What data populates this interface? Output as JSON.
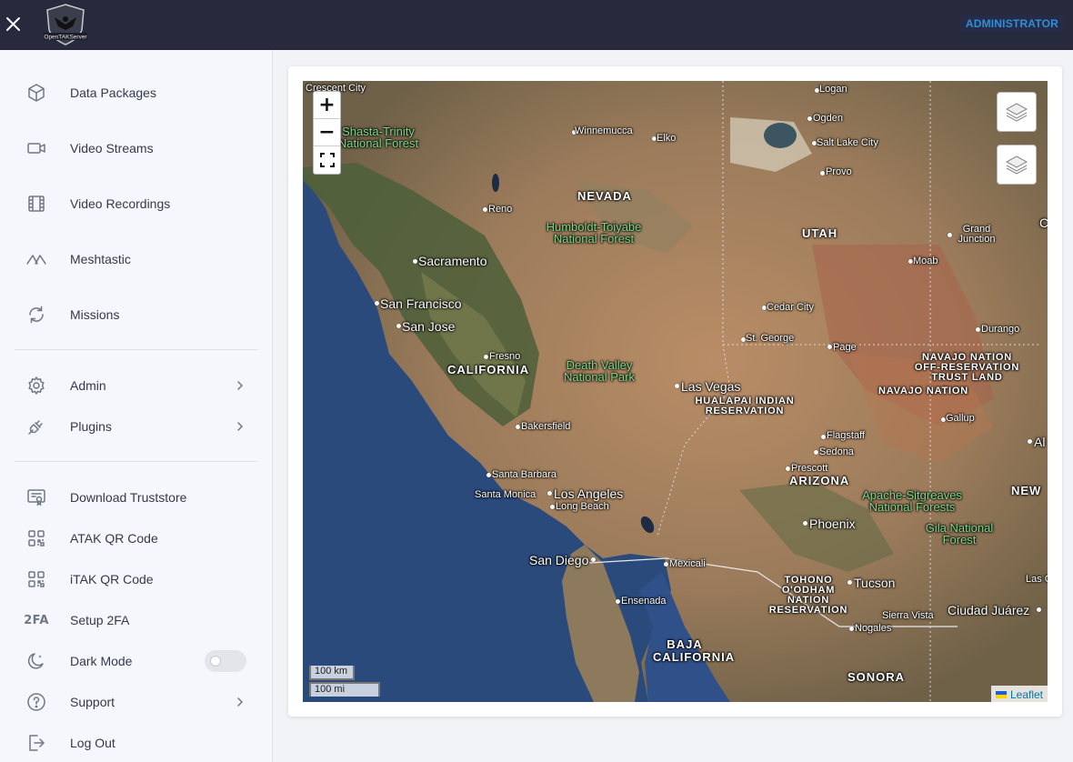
{
  "header": {
    "logo_text": "OpenTAKServer",
    "role_badge": "ADMINISTRATOR"
  },
  "sidebar": {
    "items": [
      {
        "label": "Data Packages",
        "icon": "box-icon"
      },
      {
        "label": "Video Streams",
        "icon": "video-camera-icon"
      },
      {
        "label": "Video Recordings",
        "icon": "film-icon"
      },
      {
        "label": "Meshtastic",
        "icon": "meshtastic-icon"
      },
      {
        "label": "Missions",
        "icon": "refresh-icon"
      },
      {
        "label": "Admin",
        "icon": "gear-icon"
      },
      {
        "label": "Plugins",
        "icon": "plug-icon"
      },
      {
        "label": "Download Truststore",
        "icon": "certificate-icon"
      },
      {
        "label": "ATAK QR Code",
        "icon": "qr-code-icon"
      },
      {
        "label": "iTAK QR Code",
        "icon": "qr-code-icon"
      },
      {
        "label": "Setup 2FA",
        "icon": "2fa-icon",
        "icon_text": "2FA"
      },
      {
        "label": "Dark Mode",
        "icon": "moon-icon",
        "toggle_on": false
      },
      {
        "label": "Support",
        "icon": "help-icon"
      },
      {
        "label": "Log Out",
        "icon": "logout-icon"
      }
    ]
  },
  "map": {
    "zoom_in": "+",
    "zoom_out": "−",
    "scale_km": "100 km",
    "scale_mi": "100 mi",
    "attribution": "Leaflet",
    "labels": {
      "crescent_city": "Crescent City",
      "shasta_trinity": "Shasta-Trinity National Forest",
      "winnemucca": "Winnemucca",
      "elko": "Elko",
      "logan": "Logan",
      "ogden": "Ogden",
      "salt_lake_city": "Salt Lake City",
      "provo": "Provo",
      "nevada": "NEVADA",
      "reno": "Reno",
      "humboldt": "Humboldt-Toiyabe National Forest",
      "utah": "UTAH",
      "grand_junction": "Grand Junction",
      "sacramento": "Sacramento",
      "moab": "Moab",
      "san_francisco": "San Francisco",
      "san_jose": "San Jose",
      "cedar_city": "Cedar City",
      "durango": "Durango",
      "st_george": "St. George",
      "page": "Page",
      "fresno": "Fresno",
      "california": "CALIFORNIA",
      "death_valley": "Death Valley National Park",
      "navajo_off": "NAVAJO NATION OFF-RESERVATION TRUST LAND",
      "las_vegas": "Las Vegas",
      "navajo_nation": "NAVAJO NATION",
      "hualapai": "HUALAPAI INDIAN RESERVATION",
      "gallup": "Gallup",
      "bakersfield": "Bakersfield",
      "flagstaff": "Flagstaff",
      "sedona": "Sedona",
      "al": "Al",
      "santa_barbara": "Santa Barbara",
      "prescott": "Prescott",
      "arizona": "ARIZONA",
      "los_angeles": "Los Angeles",
      "santa_monica": "Santa Monica",
      "long_beach": "Long Beach",
      "apache": "Apache-Sitgreaves National Forests",
      "new": "NEW",
      "phoenix": "Phoenix",
      "gila": "Gila National Forest",
      "san_diego": "San Diego",
      "mexicali": "Mexicali",
      "tohono": "TOHONO O'ODHAM NATION RESERVATION",
      "tucson": "Tucson",
      "las_c": "Las C",
      "ensenada": "Ensenada",
      "ciudad_juarez": "Ciudad Juárez",
      "sierra_vista": "Sierra Vista",
      "nogales": "Nogales",
      "baja_california": "BAJA CALIFORNIA",
      "sonora": "SONORA",
      "c_edge": "C"
    }
  }
}
